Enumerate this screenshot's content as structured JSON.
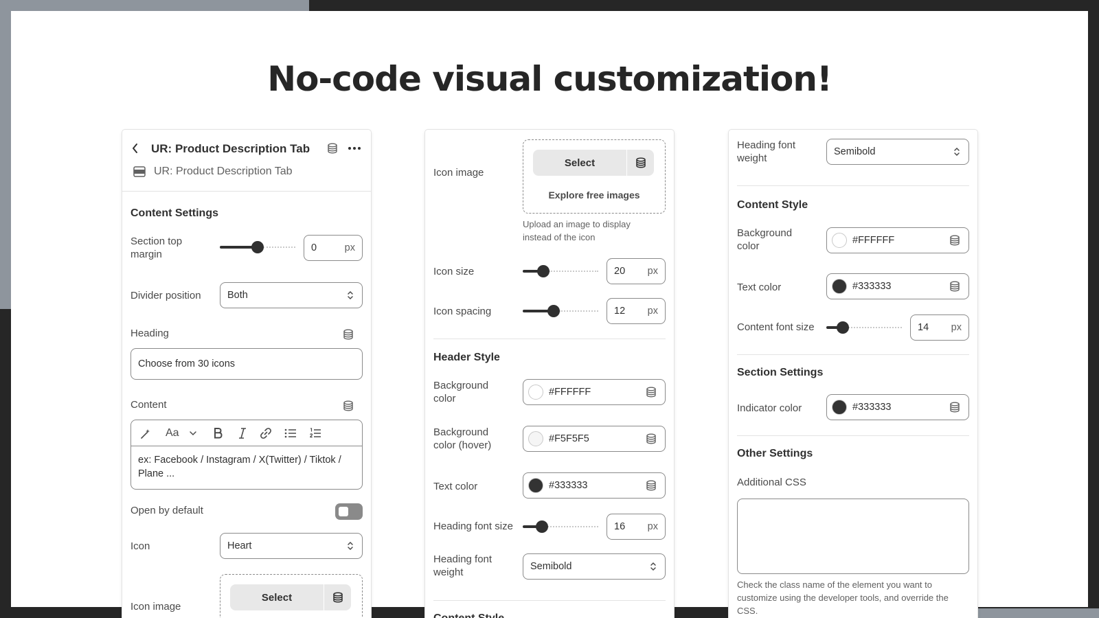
{
  "title": "No-code visual customization!",
  "panel1": {
    "header_title": "UR: Product Description Tab",
    "sub_title": "UR: Product Description Tab",
    "content_settings": "Content Settings",
    "section_top_margin": {
      "label": "Section top margin",
      "value": "0",
      "unit": "px",
      "level": 0.5
    },
    "divider_position": {
      "label": "Divider position",
      "value": "Both"
    },
    "heading": {
      "label": "Heading",
      "value": "Choose from 30 icons"
    },
    "content": {
      "label": "Content",
      "value": "ex: Facebook / Instagram / X(Twitter) / Tiktok / Plane ...",
      "toolbar_font": "Aa"
    },
    "open_by_default": {
      "label": "Open by default",
      "on": false
    },
    "icon": {
      "label": "Icon",
      "value": "Heart"
    },
    "icon_image": {
      "label": "Icon image",
      "select": "Select"
    }
  },
  "panel2": {
    "icon_image": {
      "label": "Icon image",
      "select": "Select",
      "explore": "Explore free images",
      "help": "Upload an image to display instead of the icon"
    },
    "icon_size": {
      "label": "Icon size",
      "value": "20",
      "unit": "px",
      "level": 0.27
    },
    "icon_spacing": {
      "label": "Icon spacing",
      "value": "12",
      "unit": "px",
      "level": 0.41
    },
    "header_style": "Header Style",
    "background_color": {
      "label": "Background color",
      "value": "#FFFFFF",
      "swatch": "#FFFFFF"
    },
    "background_color_hover": {
      "label": "Background color (hover)",
      "value": "#F5F5F5",
      "swatch": "#F5F5F5"
    },
    "text_color": {
      "label": "Text color",
      "value": "#333333",
      "swatch": "#333333"
    },
    "heading_font_size": {
      "label": "Heading font size",
      "value": "16",
      "unit": "px",
      "level": 0.25
    },
    "heading_font_weight": {
      "label": "Heading font weight",
      "value": "Semibold"
    },
    "content_style_partial": "Content Style"
  },
  "panel3": {
    "heading_font_weight": {
      "label": "Heading font weight",
      "value": "Semibold"
    },
    "content_style": "Content Style",
    "background_color": {
      "label": "Background color",
      "value": "#FFFFFF",
      "swatch": "#FFFFFF"
    },
    "text_color": {
      "label": "Text color",
      "value": "#333333",
      "swatch": "#333333"
    },
    "content_font_size": {
      "label": "Content font size",
      "value": "14",
      "unit": "px",
      "level": 0.22
    },
    "section_settings": "Section Settings",
    "indicator_color": {
      "label": "Indicator color",
      "value": "#333333",
      "swatch": "#333333"
    },
    "other_settings": "Other Settings",
    "additional_css": {
      "label": "Additional CSS",
      "value": "",
      "help": "Check the class name of the element you want to customize using the developer tools, and override the CSS."
    }
  },
  "icons": [
    "chevron-left-icon",
    "database-icon",
    "more-icon",
    "section-icon",
    "magic-icon",
    "bold-icon",
    "italic-icon",
    "link-icon",
    "bullet-list-icon",
    "numbered-list-icon",
    "select-chevron-icon",
    "toggle-icon"
  ]
}
